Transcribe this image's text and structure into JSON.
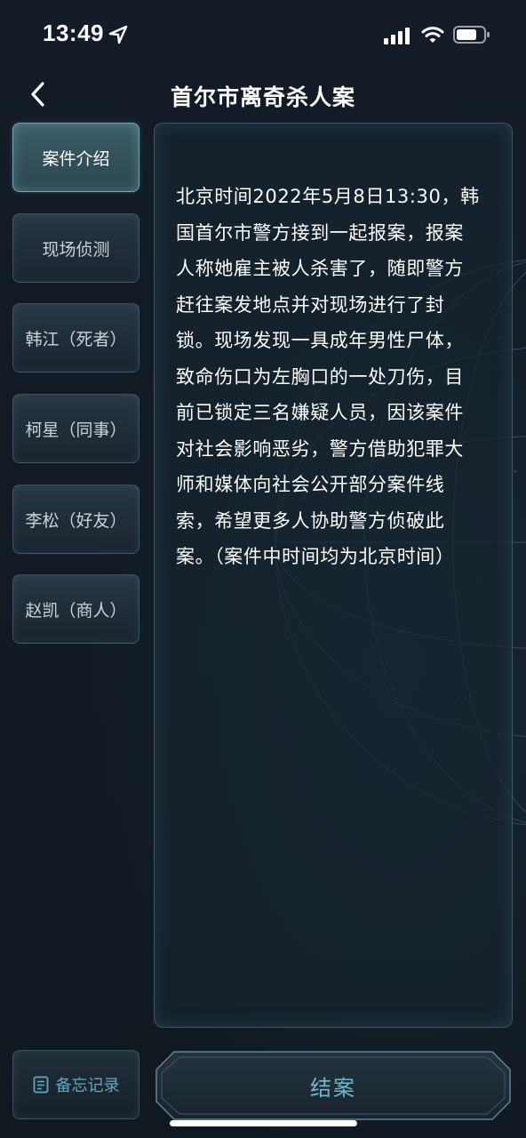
{
  "status_bar": {
    "time": "13:49"
  },
  "header": {
    "title": "首尔市离奇杀人案"
  },
  "side_tabs": [
    {
      "label": "案件介绍",
      "active": true
    },
    {
      "label": "现场侦测",
      "active": false
    },
    {
      "label": "韩江（死者）",
      "active": false
    },
    {
      "label": "柯星（同事）",
      "active": false
    },
    {
      "label": "李松（好友）",
      "active": false
    },
    {
      "label": "赵凯（商人）",
      "active": false
    }
  ],
  "content": {
    "lines": [
      "北京时间2022年5月8日13:30，韩",
      "国首尔市警方接到一起报案，报案",
      "人称她雇主被人杀害了，随即警方",
      "赶往案发地点并对现场进行了封",
      "锁。现场发现一具成年男性尸体，",
      "致命伤口为左胸口的一处刀伤，目",
      "前已锁定三名嫌疑人员，因该案件",
      "对社会影响恶劣，警方借助犯罪大",
      "师和媒体向社会公开部分案件线",
      "索，希望更多人协助警方侦破此",
      "案。（案件中时间均为北京时间）"
    ]
  },
  "footer": {
    "memo_label": "备忘记录",
    "close_case_label": "结案"
  },
  "colors": {
    "background": "#121a24",
    "accent": "#6fb6cf",
    "active_tab": "#3c5c66"
  },
  "icons": {
    "back": "chevron-left-icon",
    "location": "location-arrow-icon",
    "signal": "cellular-signal-icon",
    "wifi": "wifi-icon",
    "battery": "battery-icon",
    "memo": "notepad-icon"
  }
}
